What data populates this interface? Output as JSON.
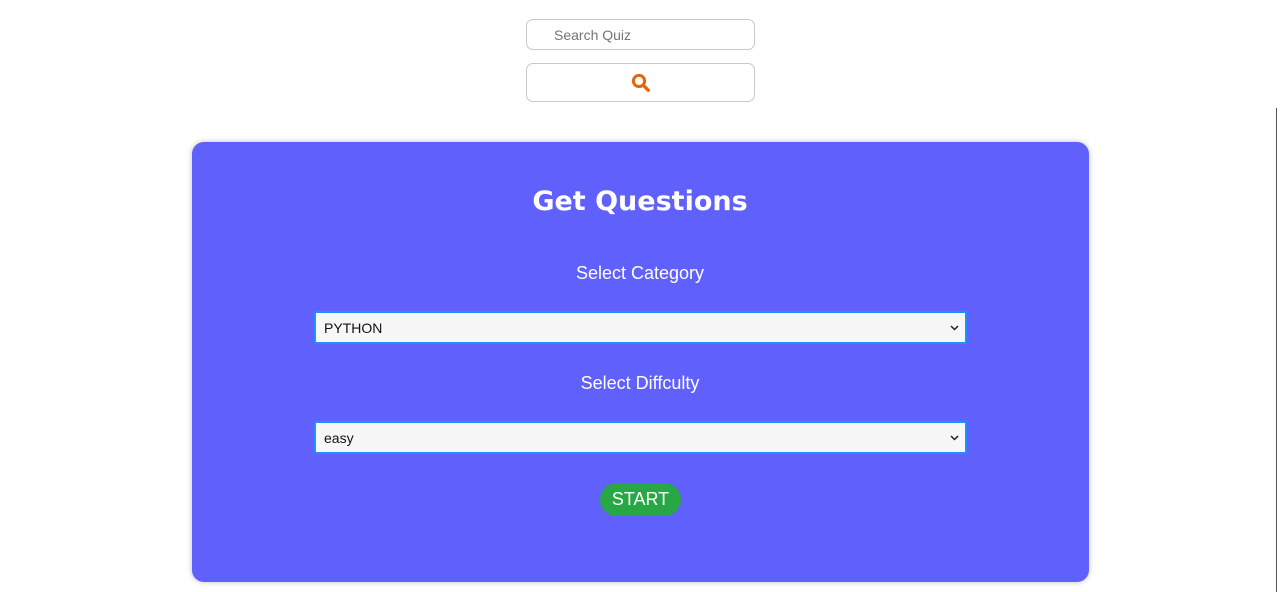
{
  "search": {
    "placeholder": "Search Quiz",
    "icon": "search-icon",
    "icon_color": "#e8650a"
  },
  "card": {
    "title": "Get Questions",
    "background": "#6060fc",
    "category": {
      "label": "Select Category",
      "selected": "PYTHON"
    },
    "difficulty": {
      "label": "Select Diffculty",
      "selected": "easy"
    },
    "start_label": "START",
    "start_color": "#28a745"
  }
}
